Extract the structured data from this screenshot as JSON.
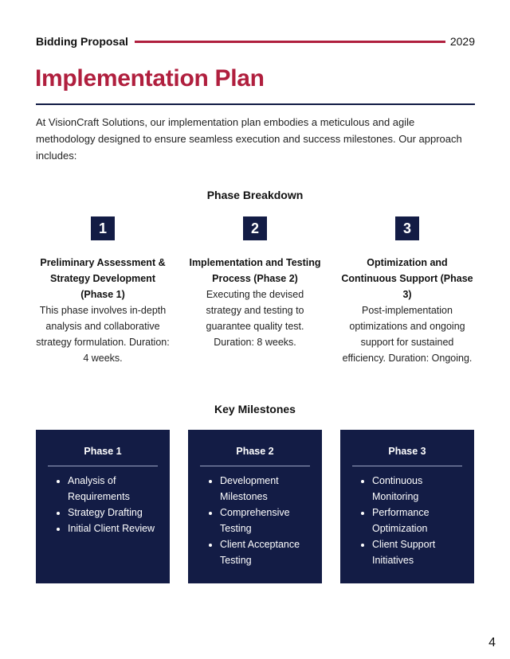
{
  "header": {
    "title": "Bidding Proposal",
    "year": "2029",
    "accent_color": "#b01f3e"
  },
  "page_title": "Implementation Plan",
  "intro": "At VisionCraft Solutions, our implementation plan embodies a meticulous and agile methodology designed to ensure seamless execution and success milestones. Our approach includes:",
  "phase_breakdown": {
    "heading": "Phase Breakdown",
    "phases": [
      {
        "number": "1",
        "title": "Preliminary Assessment & Strategy Development (Phase 1)",
        "description": "This phase involves in-depth analysis and collaborative strategy formulation. Duration: 4 weeks."
      },
      {
        "number": "2",
        "title": "Implementation and Testing Process (Phase 2)",
        "description": "Executing the devised strategy and testing to guarantee quality test. Duration: 8 weeks."
      },
      {
        "number": "3",
        "title": "Optimization and Continuous Support (Phase 3)",
        "description": "Post-implementation optimizations and ongoing support for sustained efficiency. Duration: Ongoing."
      }
    ]
  },
  "key_milestones": {
    "heading": "Key Milestones",
    "cards": [
      {
        "title": "Phase 1",
        "items": [
          "Analysis of Requirements",
          "Strategy Drafting",
          "Initial Client Review"
        ]
      },
      {
        "title": "Phase 2",
        "items": [
          "Development Milestones",
          "Comprehensive Testing",
          "Client Acceptance Testing"
        ]
      },
      {
        "title": "Phase 3",
        "items": [
          "Continuous Monitoring",
          "Performance Optimization",
          "Client Support Initiatives"
        ]
      }
    ],
    "card_color": "#131c45"
  },
  "page_number": "4"
}
